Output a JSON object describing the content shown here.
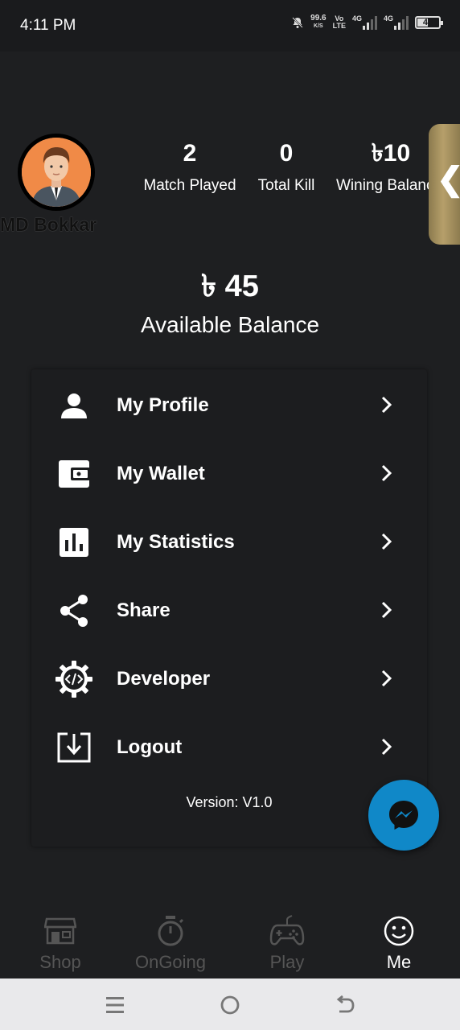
{
  "status_bar": {
    "time": "4:11 PM",
    "net_speed_value": "99.6",
    "net_speed_unit": "K/S",
    "volte_top": "Vo",
    "volte_bottom": "LTE",
    "sim1_label": "4G",
    "sim2_label": "4G",
    "battery_level": "48"
  },
  "profile": {
    "name": "MD Bokkar"
  },
  "stats": [
    {
      "value": "2",
      "label": "Match Played"
    },
    {
      "value": "0",
      "label": "Total Kill"
    },
    {
      "value": "৳10",
      "label": "Wining Balanc"
    }
  ],
  "side_tab": {
    "glyph": "❮"
  },
  "balance": {
    "amount": "৳ 45",
    "label": "Available Balance"
  },
  "menu": {
    "items": [
      {
        "label": "My Profile",
        "icon": "person-icon"
      },
      {
        "label": "My Wallet",
        "icon": "wallet-icon"
      },
      {
        "label": "My Statistics",
        "icon": "bar-chart-icon"
      },
      {
        "label": "Share",
        "icon": "share-icon"
      },
      {
        "label": "Developer",
        "icon": "developer-gear-icon"
      },
      {
        "label": "Logout",
        "icon": "logout-icon"
      }
    ],
    "version": "Version: V1.0"
  },
  "bottom_nav": {
    "items": [
      {
        "label": "Shop",
        "icon": "store-icon",
        "active": false
      },
      {
        "label": "OnGoing",
        "icon": "stopwatch-icon",
        "active": false
      },
      {
        "label": "Play",
        "icon": "gamepad-icon",
        "active": false
      },
      {
        "label": "Me",
        "icon": "smiley-icon",
        "active": true
      }
    ]
  },
  "colors": {
    "background": "#1e1f21",
    "fab": "#1088c8",
    "side_tab": "#b69f6a",
    "inactive_nav": "#555555"
  }
}
